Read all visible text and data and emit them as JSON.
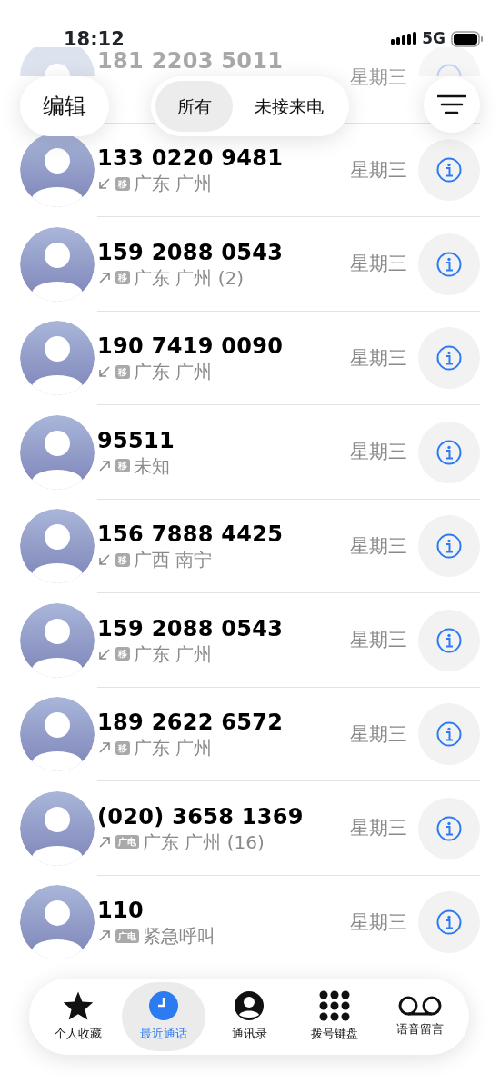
{
  "status_bar": {
    "time": "18:12",
    "network": "5G"
  },
  "header": {
    "edit": "编辑",
    "filters": [
      {
        "label": "所有",
        "selected": true
      },
      {
        "label": "未接来电",
        "selected": false
      }
    ]
  },
  "faded_call": {
    "number": "181 2203 5011",
    "day": "星期三"
  },
  "calls": [
    {
      "number": "133 0220 9481",
      "kind": "incoming",
      "carrier": "移",
      "location": "广东 广州",
      "day": "星期三"
    },
    {
      "number": "159 2088 0543",
      "kind": "outgoing",
      "carrier": "移",
      "location": "广东 广州 (2)",
      "day": "星期三"
    },
    {
      "number": "190 7419 0090",
      "kind": "incoming",
      "carrier": "移",
      "location": "广东 广州",
      "day": "星期三"
    },
    {
      "number": "95511",
      "kind": "outgoing",
      "carrier": "移",
      "location": "未知",
      "day": "星期三"
    },
    {
      "number": "156 7888 4425",
      "kind": "incoming",
      "carrier": "移",
      "location": "广西 南宁",
      "day": "星期三"
    },
    {
      "number": "159 2088 0543",
      "kind": "incoming",
      "carrier": "移",
      "location": "广东 广州",
      "day": "星期三"
    },
    {
      "number": "189 2622 6572",
      "kind": "outgoing",
      "carrier": "移",
      "location": "广东 广州",
      "day": "星期三"
    },
    {
      "number": "(020) 3658 1369",
      "kind": "outgoing",
      "carrier": "广电",
      "location": "广东 广州 (16)",
      "day": "星期三"
    },
    {
      "number": "110",
      "kind": "outgoing",
      "carrier": "广电",
      "location": "紧急呼叫",
      "day": "星期三"
    }
  ],
  "tab_bar": [
    {
      "label": "个人收藏",
      "selected": false
    },
    {
      "label": "最近通话",
      "selected": true
    },
    {
      "label": "通讯录",
      "selected": false
    },
    {
      "label": "拨号键盘",
      "selected": false
    },
    {
      "label": "语音留言",
      "selected": false
    }
  ]
}
